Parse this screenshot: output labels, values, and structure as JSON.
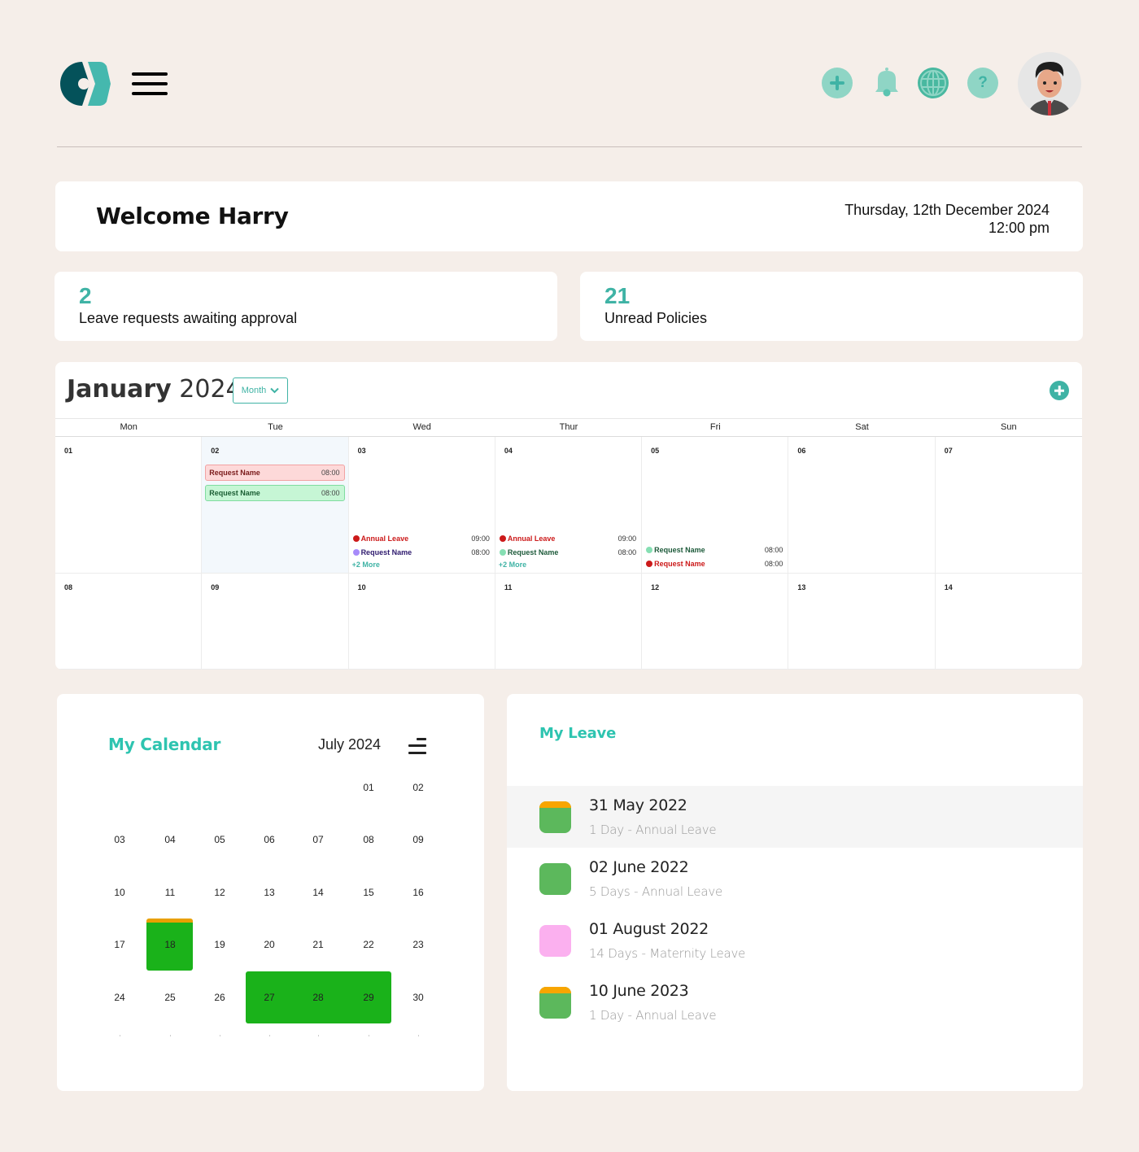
{
  "header": {
    "logo_alt": "App logo",
    "menu_label": "Menu",
    "icons": [
      "add-icon",
      "bell-icon",
      "globe-icon",
      "help-icon"
    ],
    "avatar_alt": "Harry"
  },
  "welcome": {
    "title": "Welcome Harry",
    "date": "Thursday, 12th December 2024",
    "time": "12:00 pm"
  },
  "stats": [
    {
      "value": "2",
      "label": "Leave requests awaiting approval"
    },
    {
      "value": "21",
      "label": "Unread Policies"
    }
  ],
  "calendar": {
    "month": "January",
    "year": "2024",
    "view": "Month",
    "weekdays": [
      "Mon",
      "Tue",
      "Wed",
      "Thur",
      "Fri",
      "Sat",
      "Sun"
    ],
    "weeks": [
      [
        "01",
        "02",
        "03",
        "04",
        "05",
        "06",
        "07"
      ],
      [
        "08",
        "09",
        "10",
        "11",
        "12",
        "13",
        "14"
      ]
    ],
    "today_day": "02",
    "tue_events": [
      {
        "name": "Request Name",
        "time": "08:00",
        "status": "rejected"
      },
      {
        "name": "Request Name",
        "time": "08:00",
        "status": "approved"
      }
    ],
    "wed_events": [
      {
        "name": "Annual Leave",
        "time": "09:00",
        "color": "#cc1a1a",
        "text_color": "#cc1a1a"
      },
      {
        "name": "Request Name",
        "time": "08:00",
        "color": "#a78bfa",
        "text_color": "#2e1a6e"
      }
    ],
    "wed_more": "+2 More",
    "thu_events": [
      {
        "name": "Annual Leave",
        "time": "09:00",
        "color": "#cc1a1a",
        "text_color": "#cc1a1a"
      },
      {
        "name": "Request Name",
        "time": "08:00",
        "color": "#86dfb3",
        "text_color": "#1d5a3a"
      }
    ],
    "thu_more": "+2 More",
    "fri_events": [
      {
        "name": "Request Name",
        "time": "08:00",
        "color": "#86dfb3",
        "text_color": "#1d5a3a"
      },
      {
        "name": "Request Name",
        "time": "08:00",
        "color": "#cc1a1a",
        "text_color": "#cc1a1a"
      }
    ]
  },
  "my_calendar": {
    "title": "My Calendar",
    "month_label": "July 2024",
    "weeks": [
      [
        "",
        "",
        "",
        "",
        "",
        "01",
        "02"
      ],
      [
        "03",
        "04",
        "05",
        "06",
        "07",
        "08",
        "09"
      ],
      [
        "10",
        "11",
        "12",
        "13",
        "14",
        "15",
        "16"
      ],
      [
        "17",
        "18",
        "19",
        "20",
        "21",
        "22",
        "23"
      ],
      [
        "24",
        "25",
        "26",
        "27",
        "28",
        "29",
        "30"
      ]
    ],
    "leave_days": [
      "18",
      "27",
      "28",
      "29"
    ],
    "half_day": "18",
    "colors": {
      "leave": "#1ab21a",
      "half_day_bar": "#e8a000"
    }
  },
  "my_leave": {
    "title": "My Leave",
    "items": [
      {
        "date": "31 May 2022",
        "desc": "1 Day - Annual Leave",
        "color": "#5cb85c",
        "half": true,
        "selected": true
      },
      {
        "date": "02 June 2022",
        "desc": "5 Days - Annual Leave",
        "color": "#5cb85c",
        "half": false,
        "selected": false
      },
      {
        "date": "01 August 2022",
        "desc": "14 Days - Maternity Leave",
        "color": "#fbb0ef",
        "half": false,
        "selected": false
      },
      {
        "date": "10 June 2023",
        "desc": "1 Day - Annual Leave",
        "color": "#5cb85c",
        "half": true,
        "selected": false
      }
    ]
  },
  "colors": {
    "accent": "#3fb3a5",
    "accent_light": "#8fd5c5",
    "background": "#f5eee9"
  }
}
